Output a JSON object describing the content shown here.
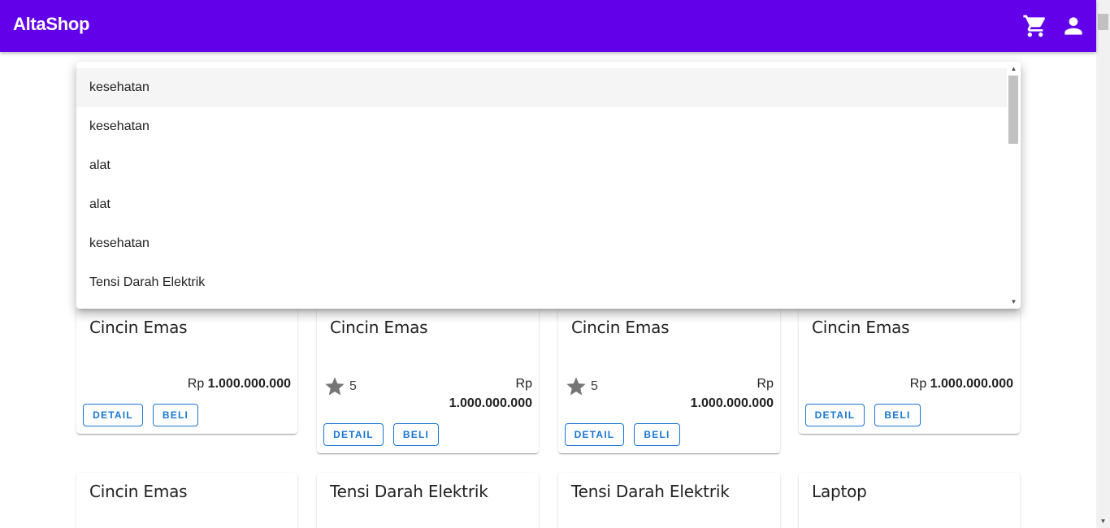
{
  "app": {
    "title": "AltaShop",
    "cart_icon": "cart-icon",
    "user_icon": "account-icon",
    "brand_color": "#6200ea",
    "accent_color": "#1976d2"
  },
  "dropdown": {
    "items": [
      "kesehatan",
      "kesehatan",
      "alat",
      "alat",
      "kesehatan",
      "Tensi Darah Elektrik"
    ]
  },
  "products": [
    {
      "title": "Cincin Emas",
      "currency": "Rp",
      "price": "1.000.000.000",
      "rating": null,
      "detail_label": "DETAIL",
      "buy_label": "BELI"
    },
    {
      "title": "Cincin Emas",
      "currency": "Rp",
      "price": "1.000.000.000",
      "rating": "5",
      "detail_label": "DETAIL",
      "buy_label": "BELI"
    },
    {
      "title": "Cincin Emas",
      "currency": "Rp",
      "price": "1.000.000.000",
      "rating": "5",
      "detail_label": "DETAIL",
      "buy_label": "BELI"
    },
    {
      "title": "Cincin Emas",
      "currency": "Rp",
      "price": "1.000.000.000",
      "rating": null,
      "detail_label": "DETAIL",
      "buy_label": "BELI"
    },
    {
      "title": "Cincin Emas"
    },
    {
      "title": "Tensi Darah Elektrik"
    },
    {
      "title": "Tensi Darah Elektrik"
    },
    {
      "title": "Laptop"
    }
  ]
}
